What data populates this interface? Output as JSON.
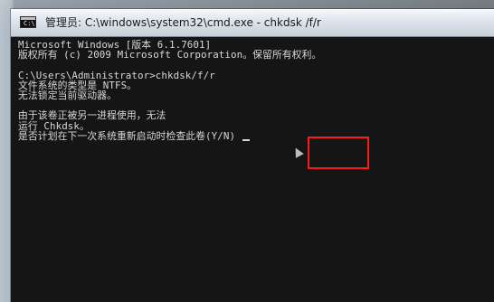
{
  "window": {
    "title": "管理员: C:\\windows\\system32\\cmd.exe - chkdsk /f/r",
    "icon": "cmd-window-icon"
  },
  "console": {
    "line1": "Microsoft Windows [版本 6.1.7601]",
    "line2": "版权所有 (c) 2009 Microsoft Corporation。保留所有权利。",
    "line3": "C:\\Users\\Administrator>chkdsk/f/r",
    "line4": "文件系统的类型是 NTFS。",
    "line5": "无法锁定当前驱动器。",
    "line6": "由于该卷正被另一进程使用，无法",
    "line7": "运行 Chkdsk。",
    "line8_prefix": "是否计划在下一次系统重新启动时检查此卷",
    "line8_choice": "(Y/N)"
  },
  "overlay": {
    "highlight_color": "#ff1a1a"
  }
}
